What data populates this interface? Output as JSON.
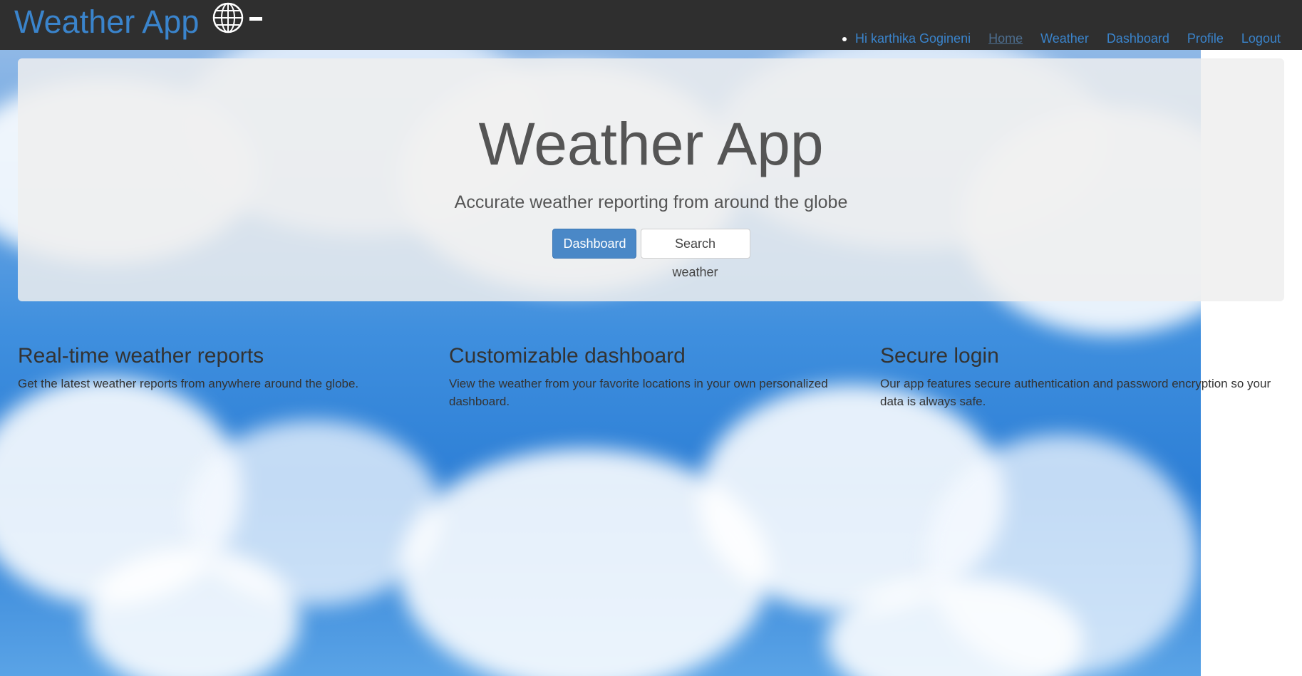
{
  "navbar": {
    "brand": "Weather App",
    "greeting": "Hi karthika Gogineni",
    "links": [
      "Home",
      "Weather",
      "Dashboard",
      "Profile",
      "Logout"
    ],
    "brand_color": "#3a84cc",
    "background": "#2f2f2f",
    "icons": {
      "globe": "globe-icon"
    }
  },
  "jumbotron": {
    "title": "Weather App",
    "subtitle": "Accurate weather reporting from around the globe",
    "primary_button": "Dashboard",
    "secondary_button": "Search weather"
  },
  "features": [
    {
      "title": "Real-time weather reports",
      "text": "Get the latest weather reports from anywhere around the globe."
    },
    {
      "title": "Customizable dashboard",
      "text": "View the weather from your favorite locations in your own personalized dashboard."
    },
    {
      "title": "Secure login",
      "text": "Our app features secure authentication and password encryption so your data is always safe."
    }
  ]
}
